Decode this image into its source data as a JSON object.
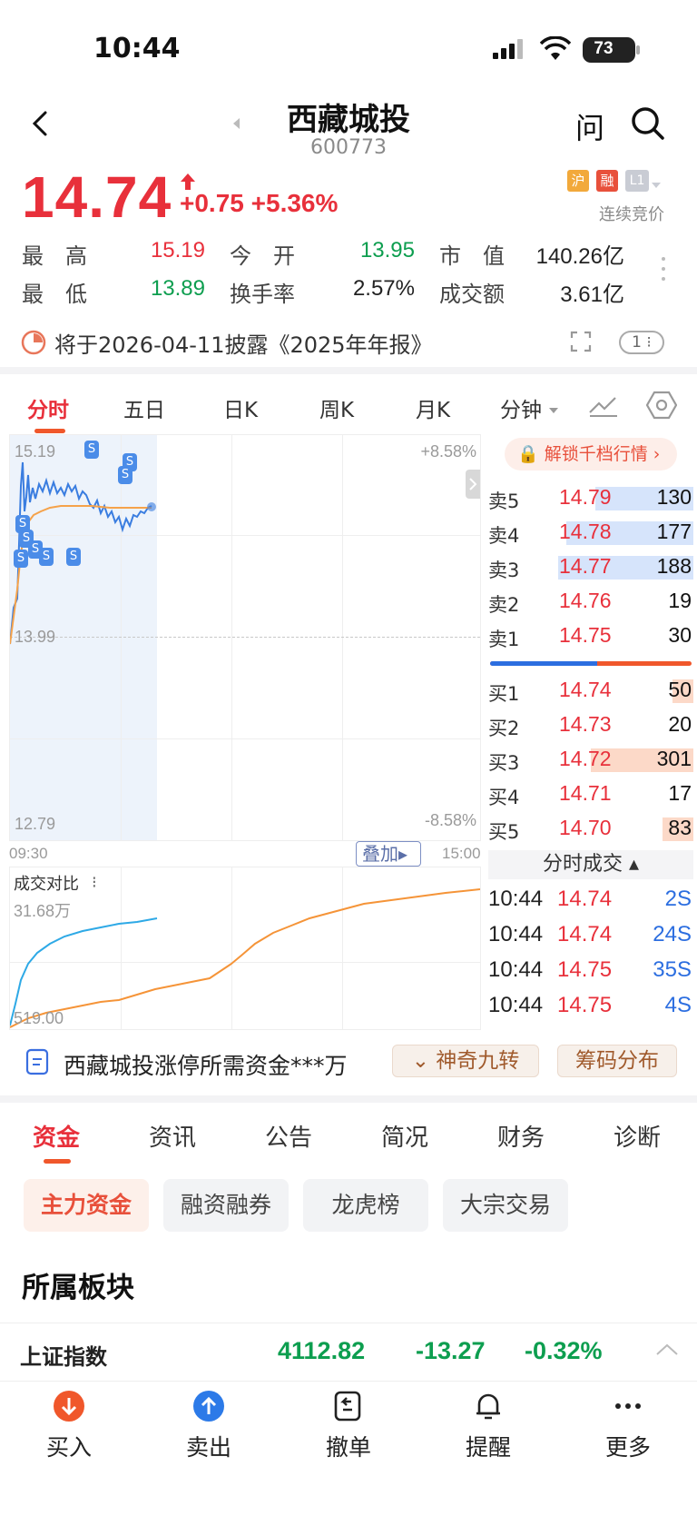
{
  "status_bar": {
    "time": "10:44",
    "battery": "73"
  },
  "header": {
    "title": "西藏城投",
    "code": "600773",
    "ask_label": "问"
  },
  "quote": {
    "price": "14.74",
    "change": "+0.75",
    "change_pct": "+5.36%",
    "badges": [
      "沪",
      "融",
      "L1"
    ],
    "trade_status": "连续竞价",
    "stats": [
      {
        "label": "最　高",
        "value": "15.19"
      },
      {
        "label": "今　开",
        "value": "13.95"
      },
      {
        "label": "市　值",
        "value": "140.26亿"
      },
      {
        "label": "最　低",
        "value": "13.89"
      },
      {
        "label": "换手率",
        "value": "2.57%"
      },
      {
        "label": "成交额",
        "value": "3.61亿"
      }
    ]
  },
  "notice": {
    "text": "将于2026-04-11披露《2025年年报》",
    "badge": "1"
  },
  "chart_tabs": [
    "分时",
    "五日",
    "日K",
    "周K",
    "月K",
    "分钟"
  ],
  "chart": {
    "y_max": "15.19",
    "y_mid": "13.99",
    "y_min": "12.79",
    "pct_max": "+8.58%",
    "pct_min": "-8.58%",
    "time_start": "09:30",
    "time_end": "15:00",
    "overlay_btn": "叠加",
    "volume_title": "成交对比",
    "volume_max": "31.68万",
    "volume_min": "519.00",
    "s_marker": "S"
  },
  "order_book": {
    "unlock_label": "解锁千档行情",
    "asks": [
      {
        "label": "卖5",
        "price": "14.79",
        "vol": "130",
        "bar": 0.48
      },
      {
        "label": "卖4",
        "price": "14.78",
        "vol": "177",
        "bar": 0.62
      },
      {
        "label": "卖3",
        "price": "14.77",
        "vol": "188",
        "bar": 0.66
      },
      {
        "label": "卖2",
        "price": "14.76",
        "vol": "19",
        "bar": 0
      },
      {
        "label": "卖1",
        "price": "14.75",
        "vol": "30",
        "bar": 0
      }
    ],
    "bids": [
      {
        "label": "买1",
        "price": "14.74",
        "vol": "50",
        "bar": 0.1
      },
      {
        "label": "买2",
        "price": "14.73",
        "vol": "20",
        "bar": 0
      },
      {
        "label": "买3",
        "price": "14.72",
        "vol": "301",
        "bar": 0.5
      },
      {
        "label": "买4",
        "price": "14.71",
        "vol": "17",
        "bar": 0
      },
      {
        "label": "买5",
        "price": "14.70",
        "vol": "83",
        "bar": 0.15
      }
    ],
    "buy_sell_ratio": 0.53,
    "ticks_title": "分时成交",
    "ticks": [
      {
        "time": "10:44",
        "price": "14.74",
        "vol": "2S"
      },
      {
        "time": "10:44",
        "price": "14.74",
        "vol": "24S"
      },
      {
        "time": "10:44",
        "price": "14.75",
        "vol": "35S"
      },
      {
        "time": "10:44",
        "price": "14.75",
        "vol": "4S"
      }
    ]
  },
  "promo": {
    "text": "西藏城投涨停所需资金***万",
    "pill1": "神奇九转",
    "pill2": "筹码分布"
  },
  "section_tabs": [
    "资金",
    "资讯",
    "公告",
    "简况",
    "财务",
    "诊断"
  ],
  "chips": [
    "主力资金",
    "融资融券",
    "龙虎榜",
    "大宗交易"
  ],
  "sector_title": "所属板块",
  "index_row": {
    "name": "上证指数",
    "value": "4112.82",
    "change": "-13.27",
    "pct": "-0.32%"
  },
  "bottom_nav": [
    "买入",
    "卖出",
    "撤单",
    "提醒",
    "更多"
  ],
  "colors": {
    "up": "#e8303b",
    "down": "#0d9e4f",
    "accent": "#f0572b",
    "price_line": "#3a7de0",
    "avg_line": "#f5a24a"
  }
}
